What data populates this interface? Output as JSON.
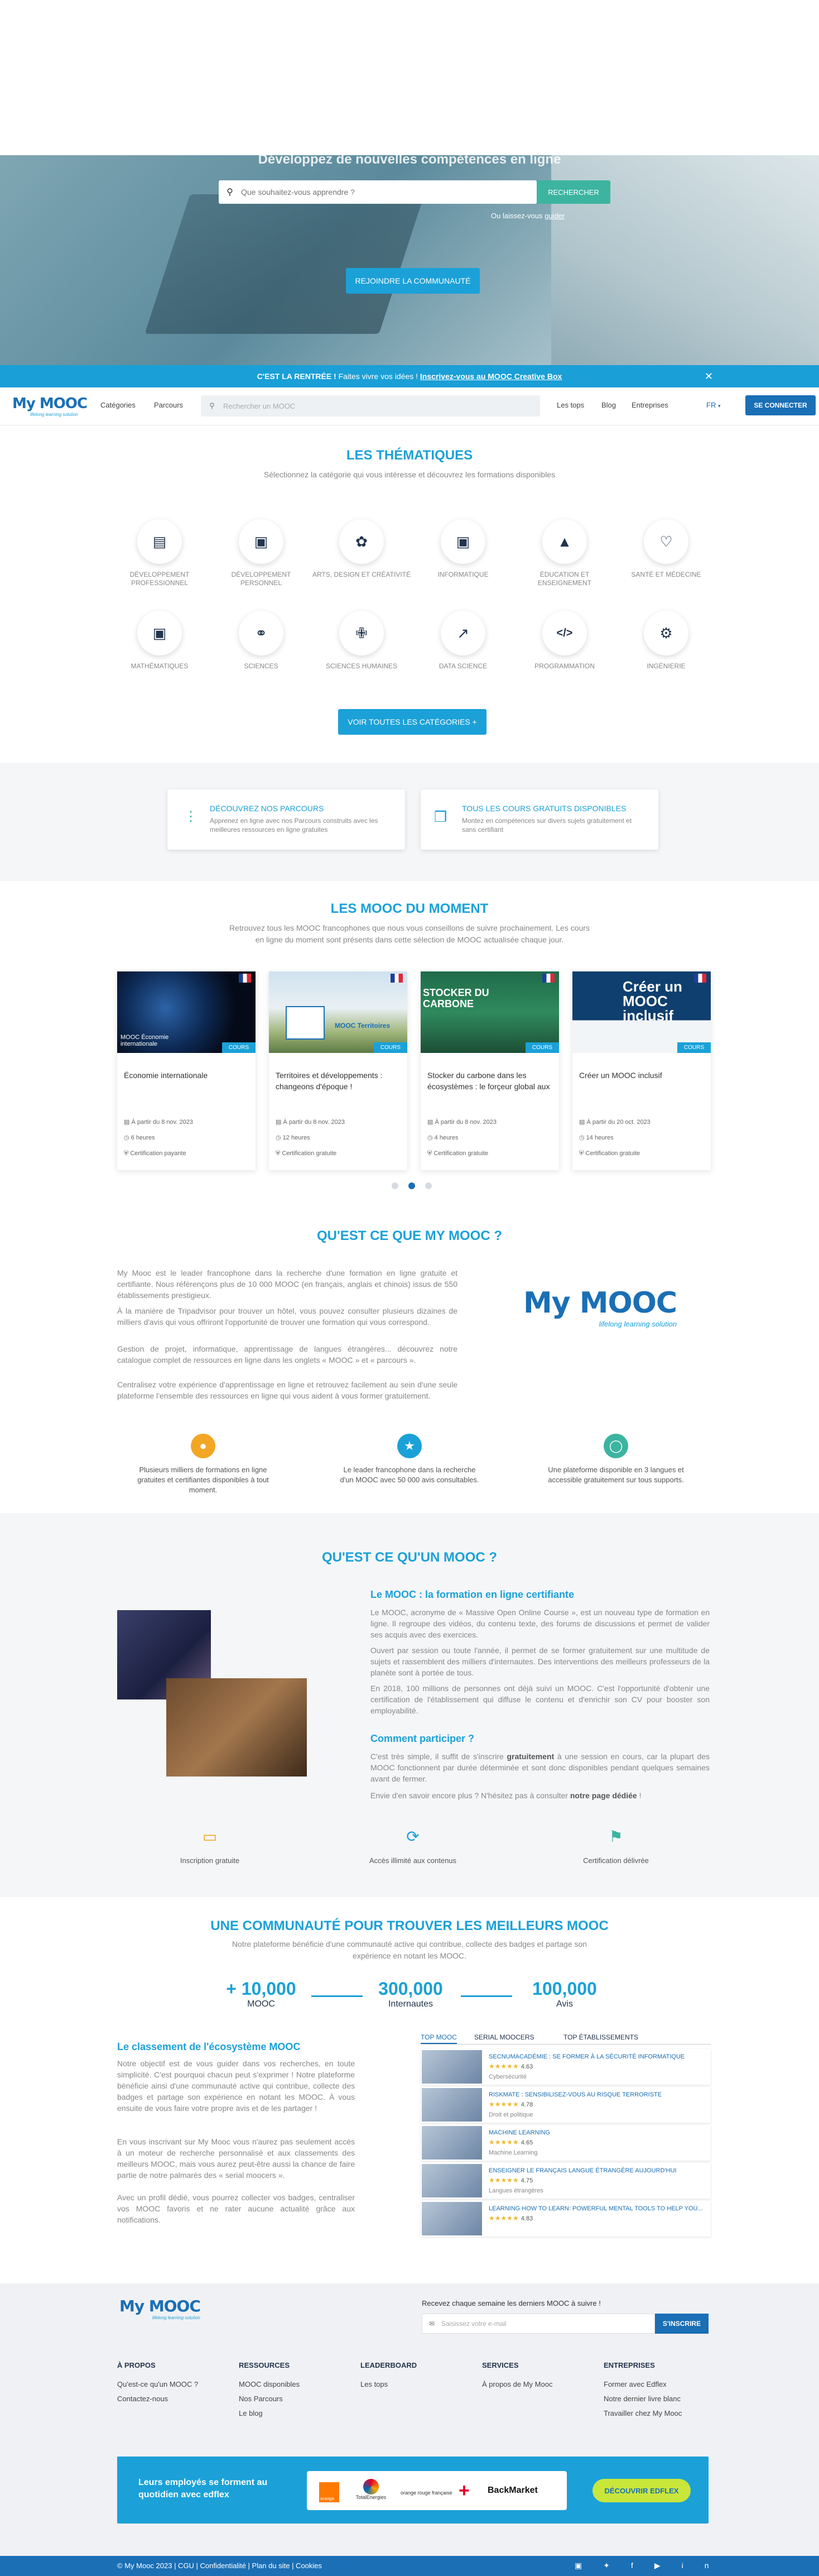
{
  "hero": {
    "title": "Développez de nouvelles compétences en ligne",
    "search_placeholder": "Que souhaitez-vous apprendre ?",
    "search_button": "RECHERCHER",
    "lost_prefix": "Ou laissez-vous ",
    "lost_link": "guider",
    "join_button": "REJOINDRE LA COMMUNAUTÉ"
  },
  "banner": {
    "lead": "C'EST LA RENTRÉE !",
    "text": " Faites vivre vos idées ! ",
    "link": "Inscrivez-vous au MOOC Creative Box"
  },
  "nav": {
    "logo": "My MOOC",
    "logo_sub": "lifelong learning solution",
    "categories": "Catégories",
    "parcours": "Parcours",
    "search_placeholder": "Rechercher un MOOC",
    "links": [
      "Les tops",
      "Blog",
      "Entreprises"
    ],
    "lang": "FR",
    "connect": "SE CONNECTER"
  },
  "themes": {
    "title": "LES THÉMATIQUES",
    "subtitle": "Sélectionnez la catégorie qui vous intéresse et découvrez les formations disponibles",
    "items": [
      {
        "label": "DÉVELOPPEMENT PROFESSIONNEL",
        "icon": "chart-icon"
      },
      {
        "label": "DÉVELOPPEMENT PERSONNEL",
        "icon": "window-icon"
      },
      {
        "label": "ARTS, DESIGN ET CRÉATIVITÉ",
        "icon": "palette-icon"
      },
      {
        "label": "INFORMATIQUE",
        "icon": "window-icon"
      },
      {
        "label": "ÉDUCATION ET ENSEIGNEMENT",
        "icon": "graduation-cap-icon"
      },
      {
        "label": "SANTÉ ET MÉDECINE",
        "icon": "heart-icon"
      },
      {
        "label": "MATHÉMATIQUES",
        "icon": "window-icon"
      },
      {
        "label": "SCIENCES",
        "icon": "molecule-icon"
      },
      {
        "label": "SCIENCES HUMAINES",
        "icon": "person-icon"
      },
      {
        "label": "DATA SCIENCE",
        "icon": "trend-icon"
      },
      {
        "label": "PROGRAMMATION",
        "icon": "code-icon"
      },
      {
        "label": "INGÉNIERIE",
        "icon": "gear-icon"
      }
    ],
    "all_button": "VOIR TOUTES LES CATÉGORIES"
  },
  "promo": {
    "parcours_title": "DÉCOUVREZ NOS PARCOURS",
    "parcours_desc": "Apprenez en ligne avec nos Parcours construits avec les meilleures ressources en ligne gratuites",
    "free_title": "TOUS LES COURS GRATUITS DISPONIBLES",
    "free_desc": "Montez en compétences sur divers sujets gratuitement et sans certifiant"
  },
  "moment": {
    "title": "LES MOOC DU MOMENT",
    "subtitle_1": "Retrouvez tous les MOOC francophones que nous vous conseillons de suivre prochainement. Les cours",
    "subtitle_2": "en ligne du moment sont présents dans cette sélection de MOOC actualisée chaque jour.",
    "tag": "COURS",
    "cards": [
      {
        "title": "Économie internationale",
        "img_text": "MOOC Économie internationale",
        "date": "À partir du 8 nov. 2023",
        "duration": "6 heures",
        "cert": "Certification payante"
      },
      {
        "title": "Territoires et développements : changeons d'époque !",
        "img_text": "MOOC Territoires",
        "date": "À partir du 8 nov. 2023",
        "duration": "12 heures",
        "cert": "Certification gratuite"
      },
      {
        "title": "Stocker du carbone dans les écosystèmes : le forçeur global aux",
        "img_text": "STOCKER DU CARBONE",
        "date": "À partir du 8 nov. 2023",
        "duration": "4 heures",
        "cert": "Certification gratuite"
      },
      {
        "title": "Créer un MOOC inclusif",
        "img_text": "Créer un MOOC inclusif",
        "date": "À partir du 20 oct. 2023",
        "duration": "14 heures",
        "cert": "Certification gratuite"
      }
    ]
  },
  "about": {
    "title": "QU'EST CE QUE MY MOOC ?",
    "paragraphs": [
      "My Mooc est le leader francophone dans la recherche d'une formation en ligne gratuite et certifiante. Nous référençons plus de 10 000 MOOC (en français, anglais et chinois) issus de 550 établissements prestigieux.",
      "À la manière de Tripadvisor pour trouver un hôtel, vous pouvez consulter plusieurs dizaines de milliers d'avis qui vous offriront l'opportunité de trouver une formation qui vous correspond.",
      "Gestion de projet, informatique, apprentissage de langues étrangères... découvrez notre catalogue complet de ressources en ligne dans les onglets « MOOC » et « parcours ».",
      "Centralisez votre expérience d'apprentissage en ligne et retrouvez facilement au sein d'une seule plateforme l'ensemble des ressources en ligne qui vous aident à vous former gratuitement."
    ],
    "features": [
      "Plusieurs milliers de formations en ligne gratuites et certifiantes disponibles à tout moment.",
      "Le leader francophone dans la recherche d'un MOOC avec 50 000 avis consultables.",
      "Une plateforme disponible en 3 langues et accessible gratuitement sur tous supports."
    ]
  },
  "mooc_def": {
    "title": "QU'EST CE QU'UN MOOC ?",
    "h_formation": "Le MOOC : la formation en ligne certifiante",
    "p1": "Le MOOC, acronyme de « Massive Open Online Course », est un nouveau type de formation en ligne. Il regroupe des vidéos, du contenu texte, des forums de discussions et permet de valider ses acquis avec des exercices.",
    "p2": "Ouvert par session ou toute l'année, il permet de se former gratuitement sur une multitude de sujets et rassemblent des milliers d'internautes. Des interventions des meilleurs professeurs de la planète sont à portée de tous.",
    "p3": "En 2018, 100 millions de personnes ont déjà suivi un MOOC. C'est l'opportunité d'obtenir une certification de l'établissement qui diffuse le contenu et d'enrichir son CV pour booster son employabilité.",
    "h_participer": "Comment participer ?",
    "p4_a": "C'est très simple, il suffit de s'inscrire ",
    "p4_b": "gratuitement",
    "p4_c": " à une session en cours, car la plupart des MOOC fonctionnent par durée déterminée et sont donc disponibles pendant quelques semaines avant de fermer.",
    "p5_a": "Envie d'en savoir encore plus ? N'hésitez pas à consulter ",
    "p5_b": "notre page dédiée",
    "p5_c": " !",
    "features": [
      "Inscription gratuite",
      "Accès illimité aux contenus",
      "Certification délivrée"
    ]
  },
  "community": {
    "title": "UNE COMMUNAUTÉ POUR TROUVER LES MEILLEURS MOOC",
    "subtitle_1": "Notre plateforme bénéficie d'une communauté active qui contribue, collecte des badges et partage son",
    "subtitle_2": "expérience en notant les MOOC.",
    "stats": [
      {
        "value": "+ 10,000",
        "label": "MOOC"
      },
      {
        "value": "300,000",
        "label": "Internautes"
      },
      {
        "value": "100,000",
        "label": "Avis"
      }
    ],
    "classement_title": "Le classement de l'écosystème MOOC",
    "c_p1": "Notre objectif est de vous guider dans vos recherches, en toute simplicité. C'est pourquoi chacun peut s'exprimer ! Notre plateforme bénéficie ainsi d'une communauté active qui contribue, collecte des badges et partage son expérience en notant les MOOC. À vous ensuite de vous faire votre propre avis et de les partager !",
    "c_p2": "En vous inscrivant sur My Mooc vous n'aurez pas seulement accès à un moteur de recherche personnalisé et aux classements des meilleurs MOOC, mais vous aurez peut-être aussi la chance de faire partie de notre palmarès des « serial moocers ».",
    "c_p3": "Avec un profil dédié, vous pourrez collecter vos badges, centraliser vos MOOC favoris et ne rater aucune actualité grâce aux notifications.",
    "tabs": [
      "TOP MOOC",
      "SERIAL MOOCERS",
      "TOP ÉTABLISSEMENTS"
    ],
    "leaderboard": [
      {
        "name": "SECNUMACADÉMIE : SE FORMER À LA SÉCURITÉ INFORMATIQUE",
        "rating": "4.63",
        "category": "Cybersécurité"
      },
      {
        "name": "RISKMATE : SENSIBILISEZ-VOUS AU RISQUE TERRORISTE",
        "rating": "4.78",
        "category": "Droit et politique"
      },
      {
        "name": "MACHINE LEARNING",
        "rating": "4.65",
        "category": "Machine Learning"
      },
      {
        "name": "ENSEIGNER LE FRANÇAIS LANGUE ÉTRANGÈRE AUJOURD'HUI",
        "rating": "4.75",
        "category": "Langues étrangères"
      },
      {
        "name": "LEARNING HOW TO LEARN: POWERFUL MENTAL TOOLS TO HELP YOU...",
        "rating": "4.83",
        "category": ""
      }
    ]
  },
  "footer": {
    "logo": "My MOOC",
    "newsletter_label": "Recevez chaque semaine les derniers MOOC à suivre !",
    "newsletter_placeholder": "Saisissez votre e-mail",
    "newsletter_button": "S'INSCRIRE",
    "cols": [
      {
        "title": "À PROPOS",
        "links": [
          "Qu'est-ce qu'un MOOC ?",
          "Contactez-nous"
        ]
      },
      {
        "title": "RESSOURCES",
        "links": [
          "MOOC disponibles",
          "Nos Parcours",
          "Le blog"
        ]
      },
      {
        "title": "LEADERBOARD",
        "links": [
          "Les tops"
        ]
      },
      {
        "title": "SERVICES",
        "links": [
          "À propos de My Mooc"
        ]
      },
      {
        "title": "ENTREPRISES",
        "links": [
          "Former avec Edflex",
          "Notre dernier livre blanc",
          "Travailler chez My Mooc"
        ]
      }
    ],
    "edflex_line1": "Leurs employés se forment au",
    "edflex_line2": "quotidien avec edflex",
    "edflex_logos": [
      "orange",
      "TotalEnergies",
      "orange rouge française",
      "BackMarket"
    ],
    "edflex_button": "DÉCOUVRIR EDFLEX",
    "bottom": "© My Mooc 2023 | CGU | Confidentialité | Plan du site | Cookies"
  }
}
